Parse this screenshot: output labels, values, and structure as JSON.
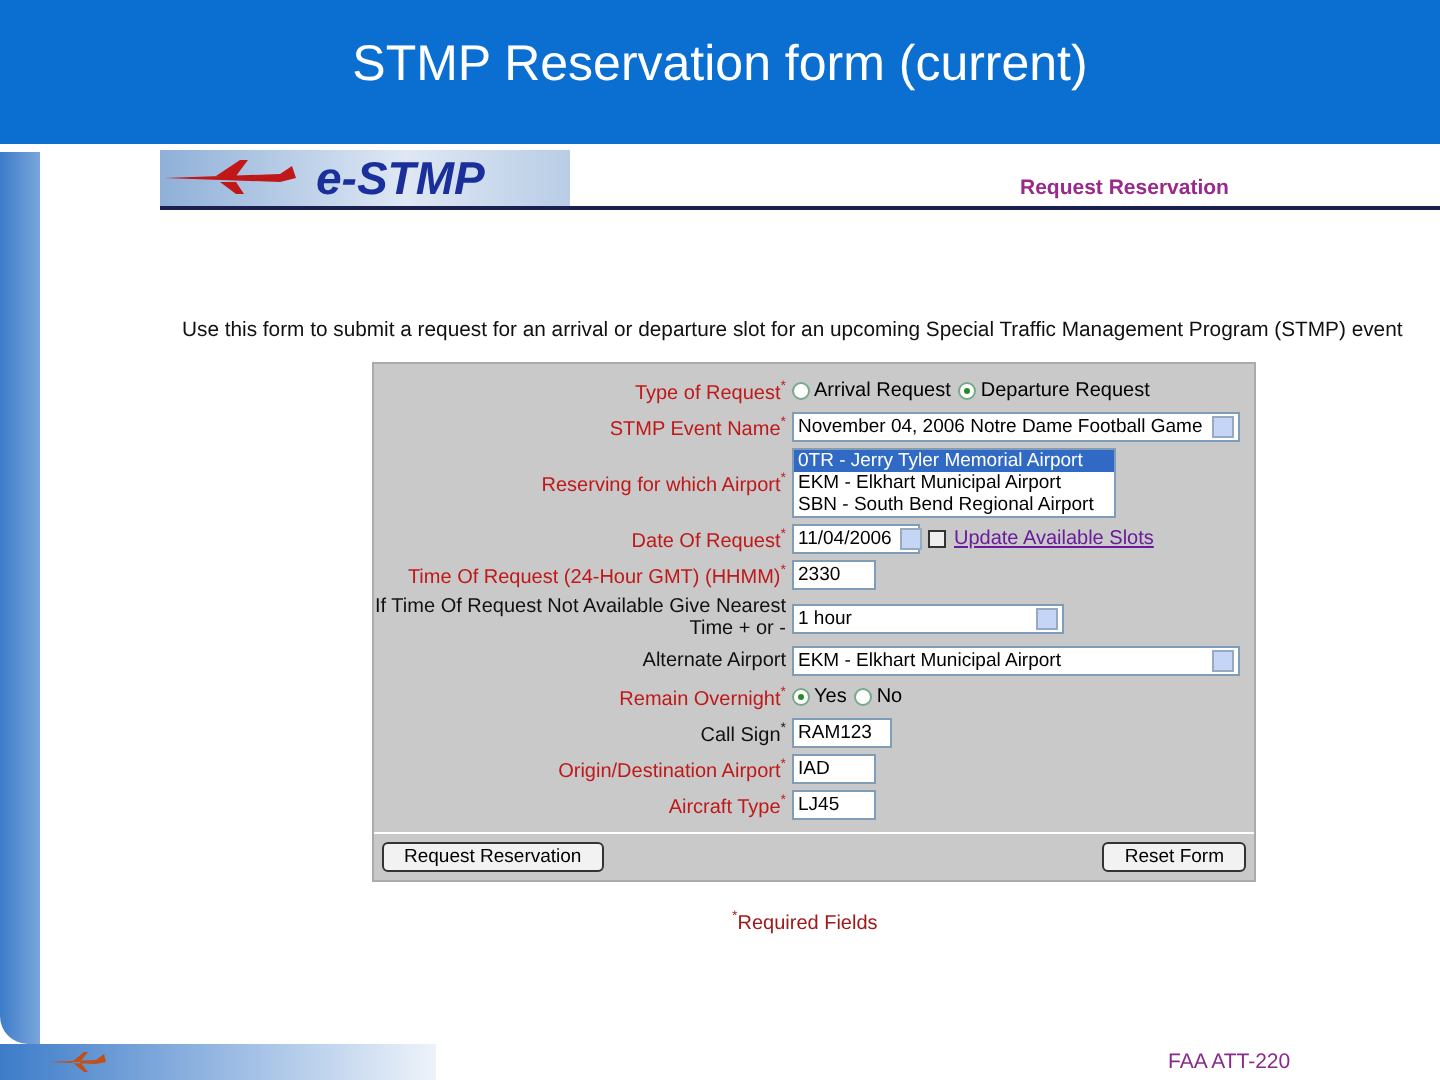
{
  "slide_title": "STMP Reservation form (current)",
  "header": {
    "logo_text": "e-STMP",
    "page_heading": "Request Reservation"
  },
  "intro": "Use this form to submit a request for an arrival or departure slot for an upcoming Special Traffic Management Program (STMP) event",
  "form": {
    "fields": [
      {
        "kind": "radio",
        "label": "Type of Request$^{*}$",
        "required": true,
        "options": [
          {
            "label": "Arrival Request",
            "selected": false
          },
          {
            "label": "Departure Request",
            "selected": true
          }
        ]
      },
      {
        "kind": "select",
        "label": "STMP Event Name$^{*}$",
        "required": true,
        "value": "November 04, 2006 Notre Dame Football Game"
      },
      {
        "kind": "listbox",
        "label": "Reserving for which Airport$^{*}$",
        "required": true,
        "options": [
          {
            "label": "0TR - Jerry Tyler Memorial Airport",
            "selected": true
          },
          {
            "label": "EKM - Elkhart Municipal Airport",
            "selected": false
          },
          {
            "label": "SBN - South Bend Regional Airport",
            "selected": false
          }
        ]
      },
      {
        "kind": "date",
        "label": "Date Of Request$^{*}$",
        "required": true,
        "value": "11/04/2006",
        "link": "Update Available Slots"
      },
      {
        "kind": "text",
        "label": "Time Of Request (24-Hour GMT) (HHMM)$^{*}$",
        "required": true,
        "value": "2330"
      },
      {
        "kind": "select",
        "label": "If Time Of Request Not Available Give Nearest Time + or -",
        "required": false,
        "value": "1 hour"
      },
      {
        "kind": "select",
        "label": "Alternate Airport",
        "required": false,
        "value": "EKM - Elkhart Municipal Airport"
      },
      {
        "kind": "radio",
        "label": "Remain Overnight$^{*}$",
        "required": true,
        "options": [
          {
            "label": "Yes",
            "selected": true
          },
          {
            "label": "No",
            "selected": false
          }
        ]
      },
      {
        "kind": "text",
        "label": "Call Sign$^{*}$",
        "required": false,
        "value": "RAM123"
      },
      {
        "kind": "text",
        "label": "Origin/Destination Airport$^{*}$",
        "required": true,
        "value": "IAD"
      },
      {
        "kind": "text",
        "label": "Aircraft Type$^{*}$",
        "required": true,
        "value": "LJ45"
      }
    ],
    "buttons": [
      "Request Reservation",
      "Reset Form"
    ]
  },
  "required_note": "$^{*}$Required Fields",
  "footer": "FAA ATT-220"
}
